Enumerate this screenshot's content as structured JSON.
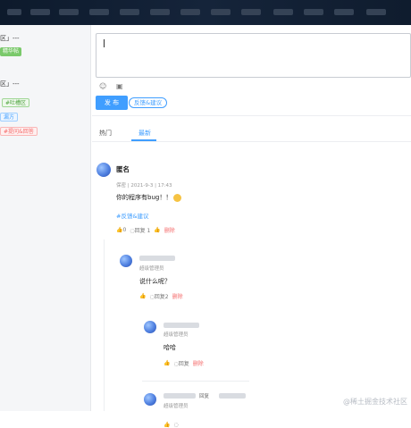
{
  "left_panel": {
    "title1": "区」---",
    "tag1": "精华帖",
    "title2": "区」---",
    "tag2": "#吐槽区",
    "tag3": "漏方",
    "tag4": "#提问&回答"
  },
  "toolbar": {
    "emoji_icon": "☺",
    "image_icon": "▣",
    "publish_label": "发 布",
    "feedback_label": "反馈&建议"
  },
  "tabs": [
    {
      "label": "热门"
    },
    {
      "label": "最新"
    }
  ],
  "post": {
    "author": "匿名",
    "meta": "保密 | 2021-9-3 | 17:43",
    "text": "你的程序有bug！！",
    "hashtag": "#反馈&建议",
    "like": "0",
    "reply": "回复 1",
    "delete": "删除"
  },
  "replies": [
    {
      "role": "超级管理员",
      "text": "说什么呢？",
      "reply": "回复2",
      "delete": "删除"
    },
    {
      "role": "超级管理员",
      "text": "哈哈",
      "reply": "回复",
      "delete": "删除"
    },
    {
      "role": "超级管理员",
      "reply_label": "回复"
    }
  ],
  "watermark": "@稀土掘金技术社区"
}
